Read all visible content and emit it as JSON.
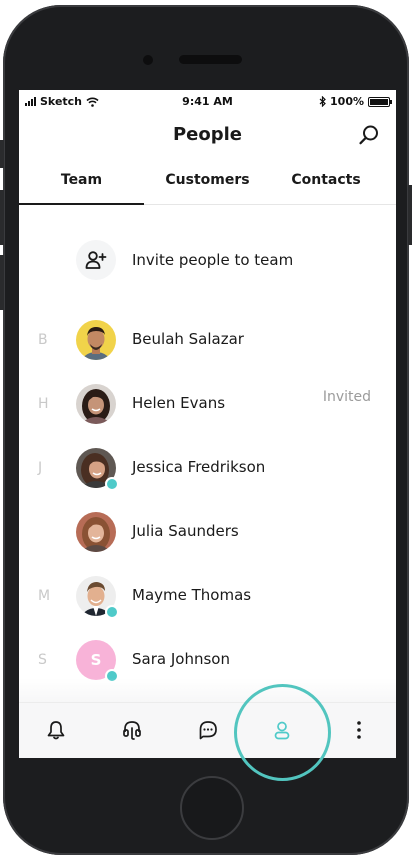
{
  "status_bar": {
    "carrier": "Sketch",
    "time": "9:41 AM",
    "battery": "100%",
    "battery_level": 1.0
  },
  "header": {
    "title": "People",
    "search_icon": "search-icon"
  },
  "tabs": [
    {
      "label": "Team",
      "active": true
    },
    {
      "label": "Customers",
      "active": false
    },
    {
      "label": "Contacts",
      "active": false
    }
  ],
  "invite": {
    "icon": "add-user-icon",
    "label": "Invite people to team"
  },
  "people": [
    {
      "letter": "B",
      "name": "Beulah Salazar",
      "status": "",
      "online": false
    },
    {
      "letter": "H",
      "name": "Helen Evans",
      "status": "Invited",
      "online": false
    },
    {
      "letter": "J",
      "name": "Jessica Fredrikson",
      "status": "",
      "online": true
    },
    {
      "letter": "",
      "name": "Julia Saunders",
      "status": "",
      "online": false
    },
    {
      "letter": "M",
      "name": "Mayme Thomas",
      "status": "",
      "online": true
    },
    {
      "letter": "S",
      "name": "Sara Johnson",
      "status": "",
      "online": true,
      "initial": "S"
    }
  ],
  "tab_bar": [
    {
      "icon": "bell-icon",
      "active": false
    },
    {
      "icon": "headset-icon",
      "active": false
    },
    {
      "icon": "chat-bubble-icon",
      "active": false
    },
    {
      "icon": "person-icon",
      "active": true
    },
    {
      "icon": "more-vertical-icon",
      "active": false
    }
  ],
  "colors": {
    "accent": "#4fcac9",
    "presence": "#4fcac9",
    "muted_text": "#9b9b9b",
    "sara_avatar": "#f8b3d8"
  }
}
